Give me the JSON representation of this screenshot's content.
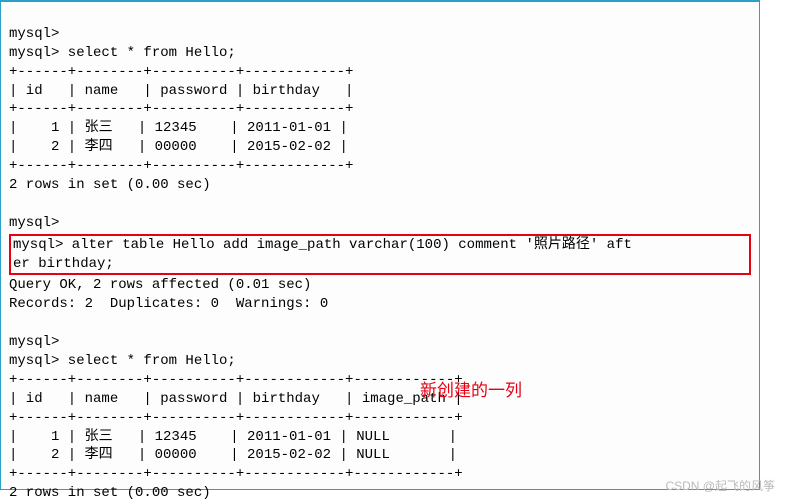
{
  "prompts": {
    "p1": "mysql>",
    "p2": "mysql> select * from Hello;"
  },
  "table1": {
    "border_top": "+------+--------+----------+------------+",
    "header": "| id   | name   | password | birthday   |",
    "border_mid": "+------+--------+----------+------------+",
    "row1": "|    1 | 张三   | 12345    | 2011-01-01 |",
    "row2": "|    2 | 李四   | 00000    | 2015-02-02 |",
    "border_bot": "+------+--------+----------+------------+",
    "summary": "2 rows in set (0.00 sec)"
  },
  "alter": {
    "line1": "mysql> alter table Hello add image_path varchar(100) comment '照片路径' aft",
    "line2": "er birthday;"
  },
  "alter_result": {
    "line1": "Query OK, 2 rows affected (0.01 sec)",
    "line2": "Records: 2  Duplicates: 0  Warnings: 0"
  },
  "table2": {
    "border_top": "+------+--------+----------+------------+------------+",
    "header": "| id   | name   | password | birthday   | image_path |",
    "border_mid": "+------+--------+----------+------------+------------+",
    "row1": "|    1 | 张三   | 12345    | 2011-01-01 | NULL       |",
    "row2": "|    2 | 李四   | 00000    | 2015-02-02 | NULL       |",
    "border_bot": "+------+--------+----------+------------+------------+",
    "summary": "2 rows in set (0.00 sec)"
  },
  "annotation": "新创建的一列",
  "watermark": "CSDN @起飞的风筝"
}
